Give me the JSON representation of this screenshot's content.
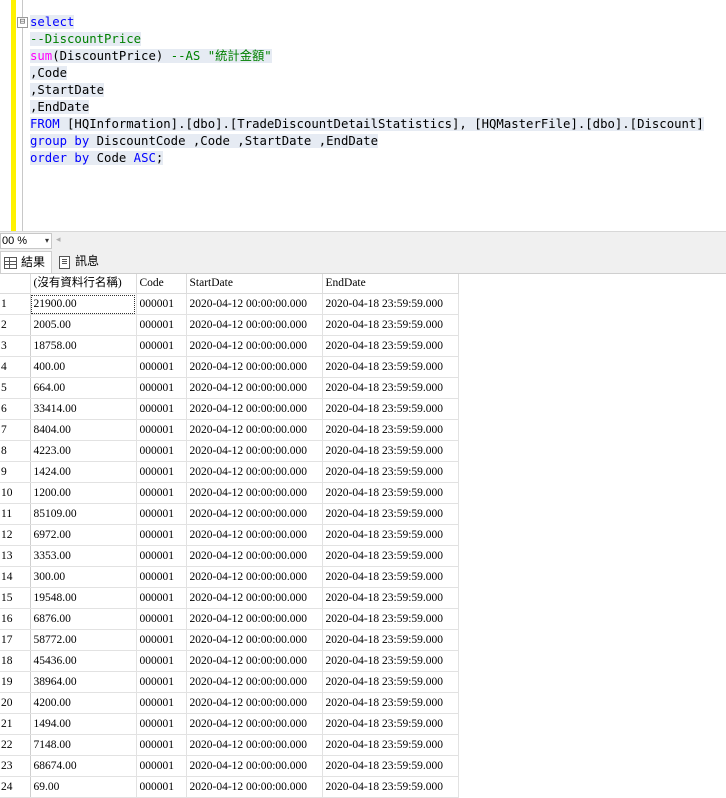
{
  "editor": {
    "collapse_glyph": "⊟",
    "lines": [
      [
        {
          "t": "select",
          "c": "kw"
        }
      ],
      [
        {
          "t": "--DiscountPrice",
          "c": "cm"
        }
      ],
      [
        {
          "t": "sum",
          "c": "fn"
        },
        {
          "t": "(DiscountPrice) ",
          "c": "tx"
        },
        {
          "t": "--AS \"統計金額\"",
          "c": "cm"
        }
      ],
      [
        {
          "t": ",Code",
          "c": "tx"
        }
      ],
      [
        {
          "t": ",StartDate",
          "c": "tx"
        }
      ],
      [
        {
          "t": ",EndDate",
          "c": "tx"
        }
      ],
      [
        {
          "t": "FROM ",
          "c": "kw"
        },
        {
          "t": "[HQInformation].[dbo].[TradeDiscountDetailStatistics], [HQMasterFile].[dbo].[Discount]",
          "c": "tx"
        }
      ],
      [
        {
          "t": "group by ",
          "c": "kw"
        },
        {
          "t": "DiscountCode ,Code ,StartDate ,EndDate",
          "c": "tx"
        }
      ],
      [
        {
          "t": "order by ",
          "c": "kw"
        },
        {
          "t": "Code ",
          "c": "tx"
        },
        {
          "t": "ASC",
          "c": "kw"
        },
        {
          "t": ";",
          "c": "tx"
        }
      ]
    ]
  },
  "zoom": {
    "value": "00 %",
    "arrow": "▾",
    "scroll_glyph": "◂"
  },
  "tabs": {
    "results": "結果",
    "messages": "訊息"
  },
  "grid": {
    "columns": [
      "(沒有資料行名稱)",
      "Code",
      "StartDate",
      "EndDate"
    ],
    "rows": [
      [
        "1",
        "21900.00",
        "000001",
        "2020-04-12 00:00:00.000",
        "2020-04-18 23:59:59.000"
      ],
      [
        "2",
        "2005.00",
        "000001",
        "2020-04-12 00:00:00.000",
        "2020-04-18 23:59:59.000"
      ],
      [
        "3",
        "18758.00",
        "000001",
        "2020-04-12 00:00:00.000",
        "2020-04-18 23:59:59.000"
      ],
      [
        "4",
        "400.00",
        "000001",
        "2020-04-12 00:00:00.000",
        "2020-04-18 23:59:59.000"
      ],
      [
        "5",
        "664.00",
        "000001",
        "2020-04-12 00:00:00.000",
        "2020-04-18 23:59:59.000"
      ],
      [
        "6",
        "33414.00",
        "000001",
        "2020-04-12 00:00:00.000",
        "2020-04-18 23:59:59.000"
      ],
      [
        "7",
        "8404.00",
        "000001",
        "2020-04-12 00:00:00.000",
        "2020-04-18 23:59:59.000"
      ],
      [
        "8",
        "4223.00",
        "000001",
        "2020-04-12 00:00:00.000",
        "2020-04-18 23:59:59.000"
      ],
      [
        "9",
        "1424.00",
        "000001",
        "2020-04-12 00:00:00.000",
        "2020-04-18 23:59:59.000"
      ],
      [
        "10",
        "1200.00",
        "000001",
        "2020-04-12 00:00:00.000",
        "2020-04-18 23:59:59.000"
      ],
      [
        "11",
        "85109.00",
        "000001",
        "2020-04-12 00:00:00.000",
        "2020-04-18 23:59:59.000"
      ],
      [
        "12",
        "6972.00",
        "000001",
        "2020-04-12 00:00:00.000",
        "2020-04-18 23:59:59.000"
      ],
      [
        "13",
        "3353.00",
        "000001",
        "2020-04-12 00:00:00.000",
        "2020-04-18 23:59:59.000"
      ],
      [
        "14",
        "300.00",
        "000001",
        "2020-04-12 00:00:00.000",
        "2020-04-18 23:59:59.000"
      ],
      [
        "15",
        "19548.00",
        "000001",
        "2020-04-12 00:00:00.000",
        "2020-04-18 23:59:59.000"
      ],
      [
        "16",
        "6876.00",
        "000001",
        "2020-04-12 00:00:00.000",
        "2020-04-18 23:59:59.000"
      ],
      [
        "17",
        "58772.00",
        "000001",
        "2020-04-12 00:00:00.000",
        "2020-04-18 23:59:59.000"
      ],
      [
        "18",
        "45436.00",
        "000001",
        "2020-04-12 00:00:00.000",
        "2020-04-18 23:59:59.000"
      ],
      [
        "19",
        "38964.00",
        "000001",
        "2020-04-12 00:00:00.000",
        "2020-04-18 23:59:59.000"
      ],
      [
        "20",
        "4200.00",
        "000001",
        "2020-04-12 00:00:00.000",
        "2020-04-18 23:59:59.000"
      ],
      [
        "21",
        "1494.00",
        "000001",
        "2020-04-12 00:00:00.000",
        "2020-04-18 23:59:59.000"
      ],
      [
        "22",
        "7148.00",
        "000001",
        "2020-04-12 00:00:00.000",
        "2020-04-18 23:59:59.000"
      ],
      [
        "23",
        "68674.00",
        "000001",
        "2020-04-12 00:00:00.000",
        "2020-04-18 23:59:59.000"
      ],
      [
        "24",
        "69.00",
        "000001",
        "2020-04-12 00:00:00.000",
        "2020-04-18 23:59:59.000"
      ]
    ]
  }
}
